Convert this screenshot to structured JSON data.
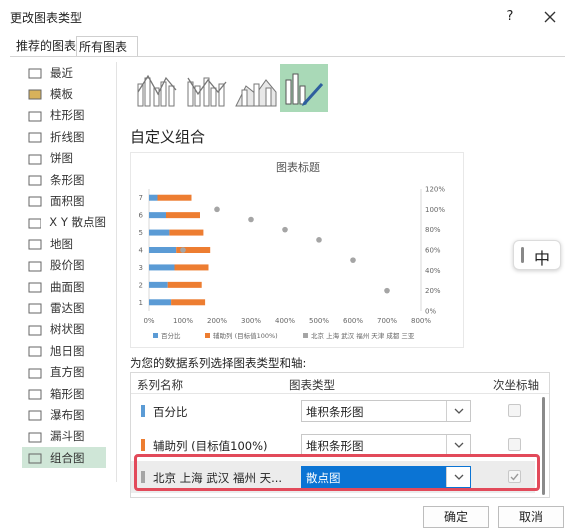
{
  "dialog": {
    "title": "更改图表类型",
    "help": "?"
  },
  "tabs": [
    {
      "label": "推荐的图表"
    },
    {
      "label": "所有图表"
    }
  ],
  "sidebar": {
    "items": [
      {
        "label": "最近",
        "icon": "recent-icon"
      },
      {
        "label": "模板",
        "icon": "folder-icon"
      },
      {
        "label": "柱形图",
        "icon": "column-chart-icon"
      },
      {
        "label": "折线图",
        "icon": "line-chart-icon"
      },
      {
        "label": "饼图",
        "icon": "pie-chart-icon"
      },
      {
        "label": "条形图",
        "icon": "bar-chart-icon"
      },
      {
        "label": "面积图",
        "icon": "area-chart-icon"
      },
      {
        "label": "X Y 散点图",
        "icon": "scatter-chart-icon"
      },
      {
        "label": "地图",
        "icon": "map-chart-icon"
      },
      {
        "label": "股价图",
        "icon": "stock-chart-icon"
      },
      {
        "label": "曲面图",
        "icon": "surface-chart-icon"
      },
      {
        "label": "雷达图",
        "icon": "radar-chart-icon"
      },
      {
        "label": "树状图",
        "icon": "treemap-chart-icon"
      },
      {
        "label": "旭日图",
        "icon": "sunburst-chart-icon"
      },
      {
        "label": "直方图",
        "icon": "histogram-chart-icon"
      },
      {
        "label": "箱形图",
        "icon": "boxplot-chart-icon"
      },
      {
        "label": "瀑布图",
        "icon": "waterfall-chart-icon"
      },
      {
        "label": "漏斗图",
        "icon": "funnel-chart-icon"
      },
      {
        "label": "组合图",
        "icon": "combo-chart-icon"
      }
    ]
  },
  "main": {
    "section_title": "自定义组合",
    "series_caption": "为您的数据系列选择图表类型和轴:",
    "table": {
      "headers": {
        "name": "系列名称",
        "type": "图表类型",
        "secondary": "次坐标轴"
      },
      "rows": [
        {
          "name": "百分比",
          "type": "堆积条形图",
          "color": "#5b9bd5"
        },
        {
          "name": "辅助列 (目标值100%)",
          "type": "堆积条形图",
          "color": "#ed7d31"
        },
        {
          "name": "北京 上海 武汉 福州 天...",
          "type": "散点图",
          "color": "#a5a5a5"
        }
      ]
    }
  },
  "ime": {
    "label": "中"
  },
  "buttons": {
    "ok": "确定",
    "cancel": "取消"
  },
  "chart_data": {
    "type": "bar",
    "title": "图表标题",
    "categories": [
      "1",
      "2",
      "3",
      "4",
      "5",
      "6",
      "7"
    ],
    "x_ticks": [
      "0%",
      "100%",
      "200%",
      "300%",
      "400%",
      "500%",
      "600%",
      "700%",
      "800%"
    ],
    "y2_ticks": [
      "0%",
      "20%",
      "40%",
      "60%",
      "80%",
      "100%",
      "120%"
    ],
    "xlim": [
      0,
      8
    ],
    "y2lim": [
      0,
      1.2
    ],
    "series": [
      {
        "name": "百分比",
        "values": [
          0.65,
          0.55,
          0.75,
          0.8,
          0.6,
          0.5,
          0.25
        ],
        "color": "#5b9bd5"
      },
      {
        "name": "辅助列 (目标值100%)",
        "values": [
          1,
          1,
          1,
          1,
          1,
          1,
          1
        ],
        "color": "#ed7d31"
      },
      {
        "name": "北京 上海 武汉 福州 天津 成都 三亚",
        "type": "scatter",
        "x": [
          1,
          2,
          3,
          4,
          5,
          6,
          7
        ],
        "y": [
          0.6,
          1.0,
          0.9,
          0.8,
          0.7,
          0.5,
          0.2
        ],
        "color": "#a5a5a5"
      }
    ],
    "legend": "bottom",
    "legend_text": [
      "百分比",
      "辅助列 (目标值100%)",
      "北京 上海 武汉 福州 天津 成都 三亚"
    ],
    "grid": false
  }
}
